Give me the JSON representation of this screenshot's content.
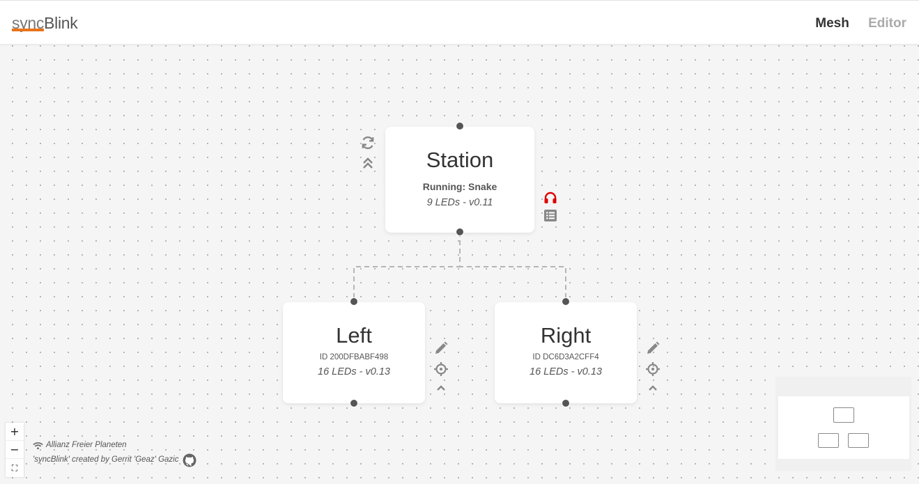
{
  "header": {
    "logo_sync": "sync",
    "logo_blink": "Blink",
    "nav": {
      "mesh_label": "Mesh",
      "editor_label": "Editor"
    }
  },
  "nodes": {
    "station": {
      "title": "Station",
      "status": "Running: Snake",
      "leds": "9 LEDs - v0.11"
    },
    "left": {
      "title": "Left",
      "id": "ID 200DFBABF498",
      "leds": "16 LEDs - v0.13"
    },
    "right": {
      "title": "Right",
      "id": "ID DC6D3A2CFF4",
      "leds": "16 LEDs - v0.13"
    }
  },
  "controls": {
    "zoom_in": "+",
    "zoom_out": "−",
    "fit_view": "⛶"
  },
  "credits": {
    "network": "Allianz Freier Planeten",
    "created_by": "'syncBlink' created by Gerrit 'Geaz' Gazic"
  },
  "icons": {
    "station_sync": "refresh-icon",
    "station_collapse": "double-chevron-up-icon",
    "station_audio": "headphones-icon",
    "station_list": "list-icon",
    "node_edit": "pencil-icon",
    "node_locate": "crosshair-icon",
    "node_collapse": "chevron-up-icon",
    "wifi": "wifi-icon",
    "github": "github-icon"
  },
  "colors": {
    "accent": "#e8731a",
    "headphones": "#e00000",
    "handle": "#555555"
  }
}
